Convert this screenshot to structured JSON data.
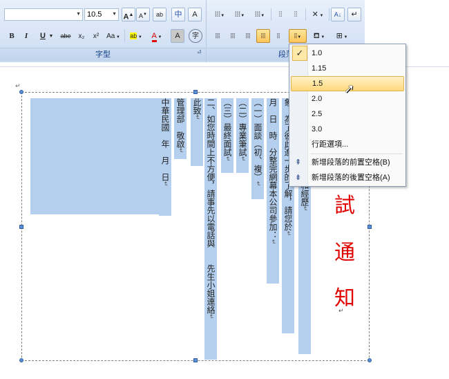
{
  "font_group": {
    "label": "字型",
    "font_name": "",
    "font_size": "10.5",
    "grow_font": "A",
    "shrink_font": "A",
    "clear_format": "ab",
    "phonetic": "中",
    "char_border": "A",
    "bold": "B",
    "italic": "I",
    "underline": "U",
    "strike": "abe",
    "subscript": "x₂",
    "superscript": "x²",
    "change_case": "Aa",
    "highlight": "ab",
    "font_color": "A",
    "char_shading": "A",
    "enclose": "字"
  },
  "paragraph_group": {
    "label": "段落"
  },
  "line_spacing_menu": {
    "items": [
      "1.0",
      "1.15",
      "1.5",
      "2.0",
      "2.5",
      "3.0"
    ],
    "checked": "1.0",
    "highlighted": "1.5",
    "options_label": "行距選項...",
    "add_before": "新增段落的前置空格(B)",
    "add_after": "新增段落的後置空格(A)"
  },
  "document": {
    "columns": [
      {
        "text": "中華民國　年　月　日"
      },
      {
        "text": "管理部　敬啟"
      },
      {
        "text": "此致"
      },
      {
        "text": "二、如您時間上不方便，請事先以電話與　　先生小姐連絡"
      },
      {
        "text": "（三）最終面試"
      },
      {
        "text": "（二）專業筆試"
      },
      {
        "text": "（一）面談（初、複）"
      },
      {
        "text": "月　日　時　分整完網幕本公司參加："
      },
      {
        "text": "象，為了彼此進一步的了解，請您於"
      },
      {
        "text": "公司　職位，您的學歷和經歷"
      }
    ],
    "title_chars": [
      "試",
      "通",
      "知"
    ]
  }
}
